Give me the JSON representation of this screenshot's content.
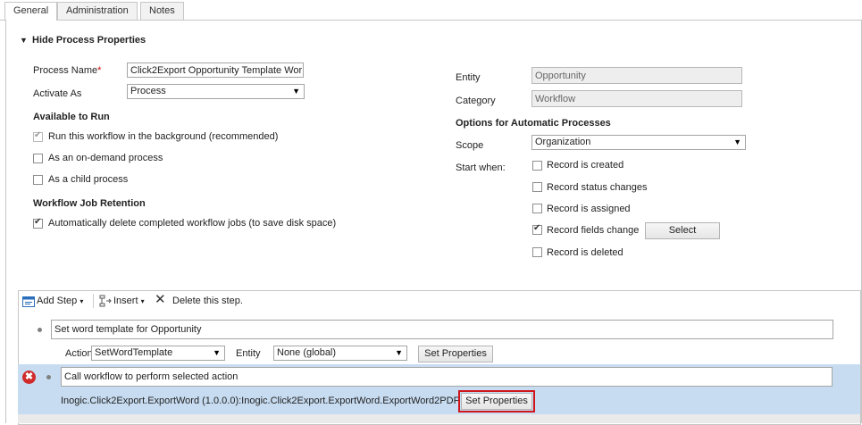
{
  "tabs": [
    {
      "label": "General"
    },
    {
      "label": "Administration"
    },
    {
      "label": "Notes"
    }
  ],
  "section": {
    "toggle_label": "Hide Process Properties"
  },
  "process_name": {
    "label": "Process Name",
    "required_mark": "*",
    "value": "Click2Export Opportunity Template Wor"
  },
  "activate_as": {
    "label": "Activate As",
    "value": "Process"
  },
  "available_to_run": {
    "heading": "Available to Run",
    "background": {
      "label": "Run this workflow in the background (recommended)",
      "checked": true
    },
    "on_demand": {
      "label": "As an on-demand process",
      "checked": false
    },
    "child": {
      "label": "As a child process",
      "checked": false
    }
  },
  "retention": {
    "heading": "Workflow Job Retention",
    "auto_delete": {
      "label": "Automatically delete completed workflow jobs (to save disk space)",
      "checked": true
    }
  },
  "entity": {
    "label": "Entity",
    "value": "Opportunity"
  },
  "category": {
    "label": "Category",
    "value": "Workflow"
  },
  "options": {
    "heading": "Options for Automatic Processes",
    "scope_label": "Scope",
    "scope_value": "Organization",
    "start_when_label": "Start when:",
    "created": "Record is created",
    "status_changes": "Record status changes",
    "assigned": "Record is assigned",
    "fields_change": "Record fields change",
    "deleted": "Record is deleted",
    "select_button": "Select"
  },
  "toolbar": {
    "add_step": "Add Step",
    "insert": "Insert",
    "delete": "Delete this step."
  },
  "step1": {
    "description": "Set word template for Opportunity",
    "action_label": "Action",
    "action_value": "SetWordTemplate",
    "entity_label": "Entity",
    "entity_value": "None (global)",
    "set_properties": "Set Properties"
  },
  "step2": {
    "description": "Call workflow to perform selected action",
    "assembly": "Inogic.Click2Export.ExportWord (1.0.0.0):Inogic.Click2Export.ExportWord.ExportWord2PDF",
    "set_properties": "Set Properties"
  },
  "icons": {
    "error": "✖",
    "dropdown": "▼",
    "collapse": "▼"
  },
  "colors": {
    "selection": "#c7dcf1",
    "highlight": "#d0141c",
    "error": "#d12a2a"
  }
}
